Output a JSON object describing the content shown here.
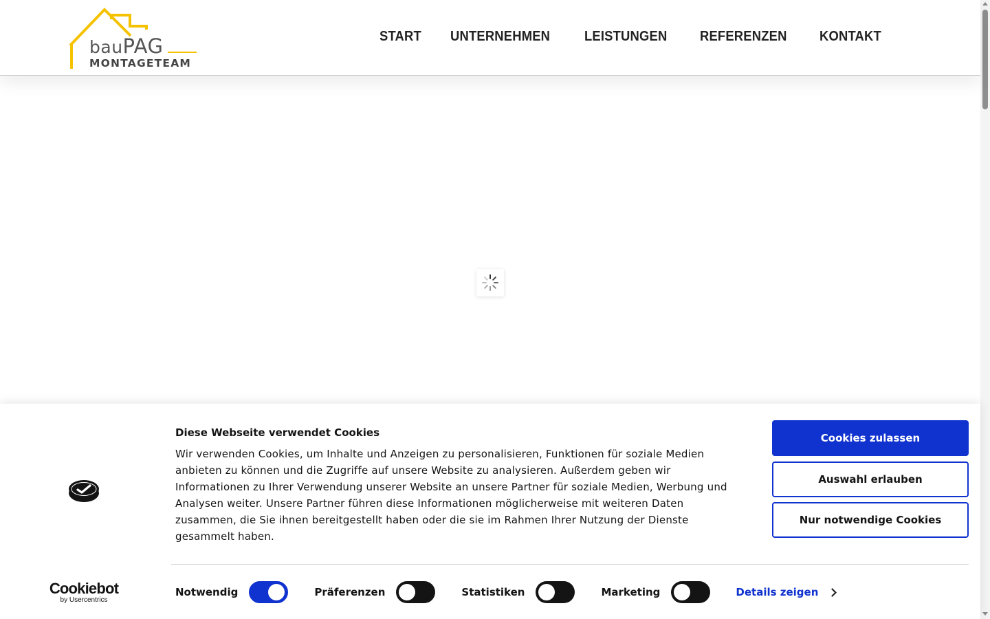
{
  "brand": {
    "logo_word_prefix": "bau",
    "logo_word_main": "PAG",
    "logo_subtitle": "MONTAGETEAM",
    "accent_color": "#f5c200"
  },
  "nav": {
    "items": [
      {
        "label": "START"
      },
      {
        "label": "UNTERNEHMEN"
      },
      {
        "label": "LEISTUNGEN"
      },
      {
        "label": "REFERENZEN"
      },
      {
        "label": "KONTAKT"
      }
    ]
  },
  "loader": {
    "icon": "spinner-icon"
  },
  "cookie_banner": {
    "title": "Diese Webseite verwendet Cookies",
    "description": "Wir verwenden Cookies, um Inhalte und Anzeigen zu personalisieren, Funktionen für soziale Medien anbieten zu können und die Zugriffe auf unsere Website zu analysieren. Außerdem geben wir Informationen zu Ihrer Verwendung unserer Website an unsere Partner für soziale Medien, Werbung und Analysen weiter. Unsere Partner führen diese Informationen möglicherweise mit weiteren Daten zusammen, die Sie ihnen bereitgestellt haben oder die sie im Rahmen Ihrer Nutzung der Dienste gesammelt haben.",
    "buttons": {
      "allow_all": "Cookies zulassen",
      "allow_selection": "Auswahl erlauben",
      "necessary_only": "Nur notwendige Cookies"
    },
    "toggles": [
      {
        "label": "Notwendig",
        "on": true
      },
      {
        "label": "Präferenzen",
        "on": false
      },
      {
        "label": "Statistiken",
        "on": false
      },
      {
        "label": "Marketing",
        "on": false
      }
    ],
    "details_link": "Details zeigen",
    "provider_name": "Cookiebot",
    "provider_by": "by Usercentrics",
    "primary_color": "#1032cf"
  }
}
